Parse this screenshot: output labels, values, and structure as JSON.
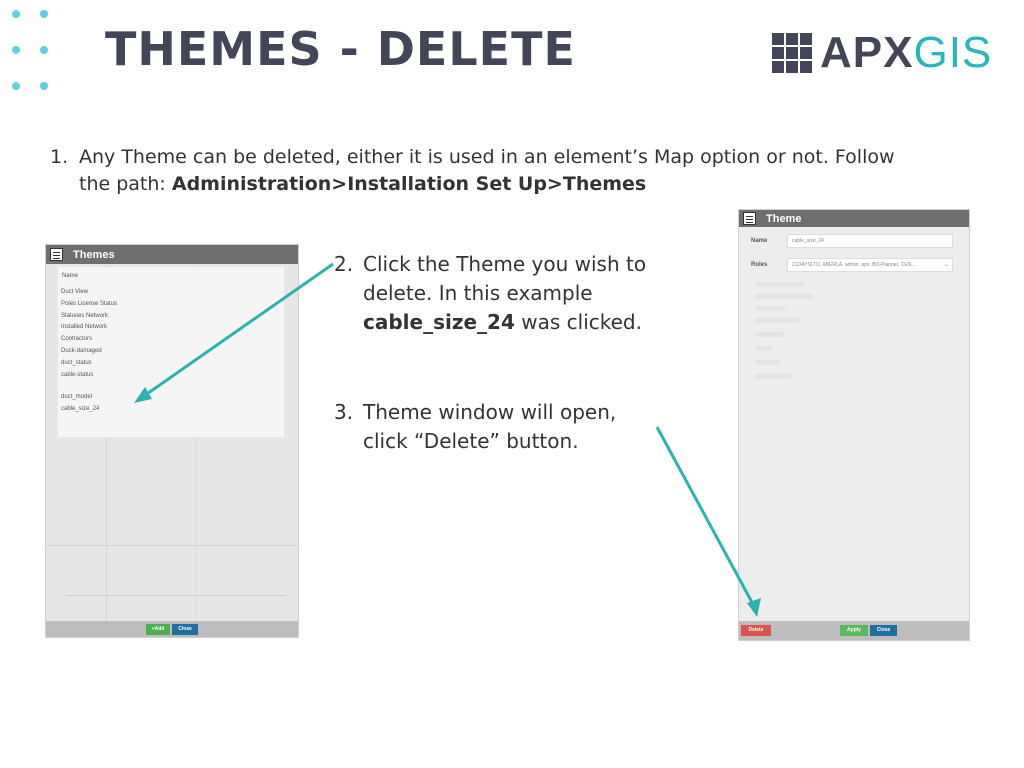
{
  "slide": {
    "title": "THEMES - DELETE",
    "logo": {
      "apx": "APX",
      "gis": "GIS"
    }
  },
  "steps": {
    "s1": {
      "num": "1.",
      "text": "Any Theme can be deleted, either it is used in an element’s Map option or not. Follow the path: ",
      "path": "Administration>Installation Set Up>Themes"
    },
    "s2": {
      "num": "2.",
      "text_a": "Click the Theme you wish to delete. In this example ",
      "bold": "cable_size_24",
      "text_b": " was clicked."
    },
    "s3": {
      "num": "3.",
      "text": "Theme window will open, click “Delete” button."
    }
  },
  "themes_panel": {
    "title": "Themes",
    "column_header": "Name",
    "items": [
      "Duct View",
      "Poles License Status",
      "Statuses Network",
      "Installed Network",
      "Contractors",
      "Duck-damaged",
      "duct_status",
      "cable-status",
      "duct_model",
      "cable_size_24"
    ],
    "add_label": "+Add",
    "close_label": "Close"
  },
  "theme_panel": {
    "title": "Theme",
    "name_label": "Name",
    "name_value": "cable_size_24",
    "roles_label": "Roles",
    "roles_value": "21DAYSLTD, ABERLA, admin, apx, BO-Planner, CEN...",
    "delete_label": "Delete",
    "apply_label": "Apply",
    "close_label": "Close"
  },
  "colors": {
    "accent": "#2bb3c0",
    "title": "#434659",
    "dots": "#5fd0df"
  }
}
